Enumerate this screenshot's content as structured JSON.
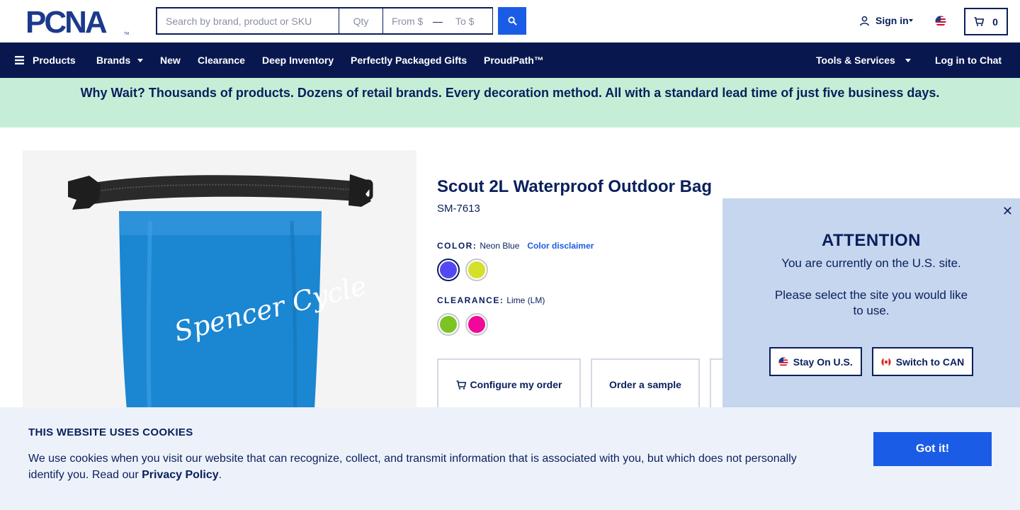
{
  "header": {
    "logo_text": "PCNA",
    "search": {
      "placeholder": "Search by brand, product or SKU",
      "value": ""
    },
    "qty": {
      "placeholder": "Qty"
    },
    "price_from": {
      "placeholder": "From $"
    },
    "price_to": {
      "placeholder": "To $"
    },
    "signin_label": "Sign in",
    "cart_count": "0"
  },
  "nav": {
    "products": "Products",
    "brands": "Brands",
    "new": "New",
    "clearance": "Clearance",
    "deep_inventory": "Deep Inventory",
    "gifts": "Perfectly Packaged Gifts",
    "proudpath": "ProudPath™",
    "tools": "Tools & Services",
    "chat": "Log in to Chat"
  },
  "banner": {
    "text": "Why Wait? Thousands of products. Dozens of retail brands. Every decoration method. All with a standard lead time of just five business days."
  },
  "product": {
    "title": "Scout 2L Waterproof Outdoor Bag",
    "sku": "SM-7613",
    "imprint_text": "Spencer Cycle",
    "color_label": "COLOR:",
    "color_value": "Neon Blue",
    "color_disclaimer": "Color disclaimer",
    "colors": [
      {
        "name": "Neon Blue",
        "hex": "#5448f2",
        "selected": true
      },
      {
        "name": "Yellow",
        "hex": "#d4e02a",
        "selected": false
      }
    ],
    "clearance_label": "CLEARANCE:",
    "clearance_value": "Lime (LM)",
    "clearance_colors": [
      {
        "name": "Lime",
        "hex": "#7cc424"
      },
      {
        "name": "Pink",
        "hex": "#f1089b"
      }
    ],
    "actions": {
      "configure": "Configure my order",
      "sample": "Order a sample"
    }
  },
  "region_popup": {
    "title": "ATTENTION",
    "message": "You are currently on the U.S. site.",
    "prompt": "Please select the site you would like to use.",
    "stay_label": "Stay On U.S.",
    "switch_label": "Switch to CAN"
  },
  "cookie": {
    "title": "THIS WEBSITE USES COOKIES",
    "text": "We use cookies when you visit our website that can recognize, collect, and transmit information that is associated with you, but which does not personally identify you. Read our ",
    "link": "Privacy Policy",
    "period": ".",
    "button": "Got it!"
  },
  "colors": {
    "navy": "#0a1f5c",
    "nav_bg": "#08184f",
    "accent_blue": "#1a5ce5",
    "banner_green": "#c6eed6",
    "popup_bg": "#c5d6ee",
    "cookie_bg": "#edf2fa",
    "bag_blue": "#1b86d1"
  }
}
